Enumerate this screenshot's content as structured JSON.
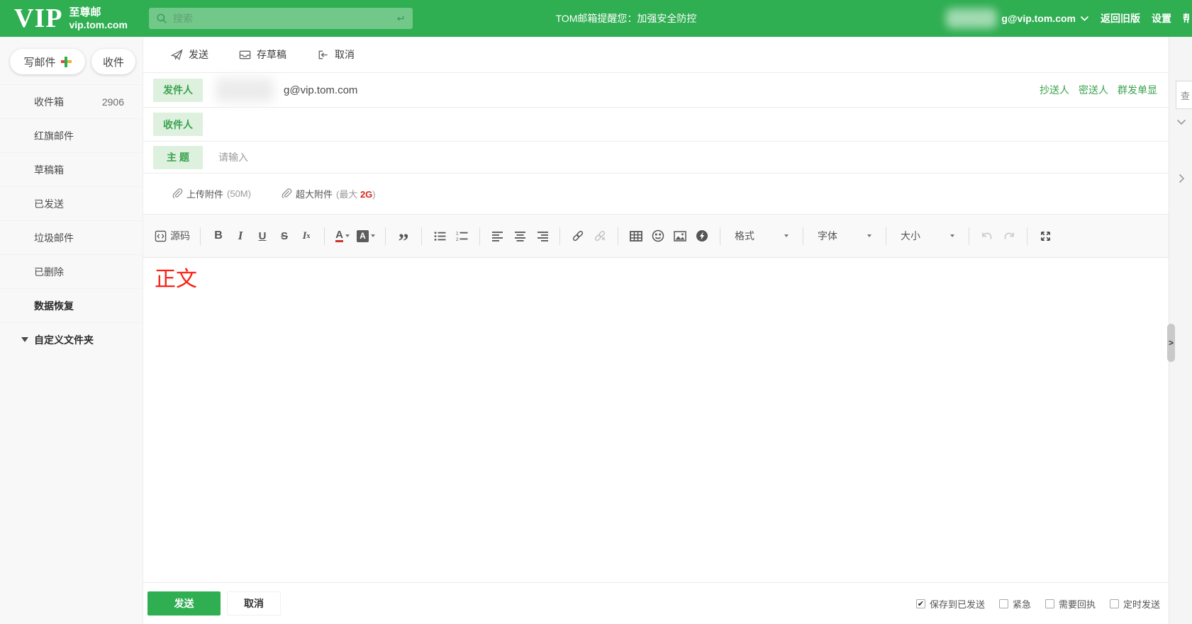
{
  "header": {
    "logo": {
      "vip": "VIP",
      "name": "至尊邮",
      "domain": "vip.tom.com"
    },
    "search_placeholder": "搜索",
    "notice": "TOM邮箱提醒您：加强安全防控",
    "user_email": "g@vip.tom.com",
    "back_old_version": "返回旧版",
    "settings": "设置",
    "clipped_item": "帮"
  },
  "sidebar": {
    "compose_button": "写邮件",
    "receive_button": "收件",
    "items": [
      {
        "label": "收件箱",
        "count": "2906"
      },
      {
        "label": "红旗邮件"
      },
      {
        "label": "草稿箱"
      },
      {
        "label": "已发送"
      },
      {
        "label": "垃圾邮件"
      },
      {
        "label": "已删除"
      },
      {
        "label": "数据恢复"
      },
      {
        "label": "自定义文件夹"
      }
    ]
  },
  "toolbar": {
    "send": "发送",
    "save_draft": "存草稿",
    "cancel": "取消"
  },
  "compose": {
    "from_label": "发件人",
    "from_value": "g@vip.tom.com",
    "to_label": "收件人",
    "subject_label": "主 题",
    "subject_placeholder": "请输入",
    "cc_link": "抄送人",
    "bcc_link": "密送人",
    "mass_single_link": "群发单显",
    "upload_label": "上传附件",
    "upload_size": "(50M)",
    "large_label": "超大附件",
    "large_prefix": "(最大 ",
    "large_value": "2G",
    "large_suffix": ")"
  },
  "editor": {
    "source_label": "源码",
    "format_dropdown": "格式",
    "font_dropdown": "字体",
    "size_dropdown": "大小",
    "body_text": "正文"
  },
  "footer": {
    "send": "发送",
    "cancel": "取消",
    "checkboxes": [
      {
        "label": "保存到已发送",
        "checked": true
      },
      {
        "label": "紧急",
        "checked": false
      },
      {
        "label": "需要回执",
        "checked": false
      },
      {
        "label": "定时发送",
        "checked": false
      }
    ]
  },
  "right_panel": {
    "search_hint": "查"
  },
  "colors": {
    "brand_green": "#2fae52",
    "chip_bg": "#def0de",
    "link_green": "#39a24d",
    "alert_red": "#d5281b",
    "body_red": "#fb2113"
  }
}
